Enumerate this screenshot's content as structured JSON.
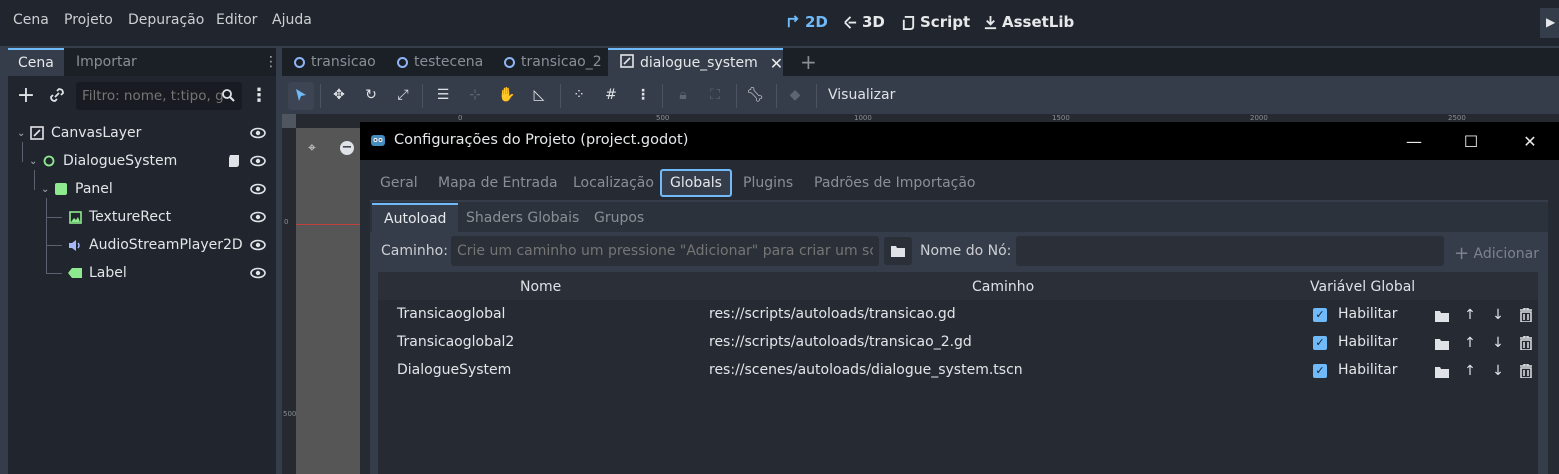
{
  "menubar": {
    "items": [
      "Cena",
      "Projeto",
      "Depuração",
      "Editor",
      "Ajuda"
    ],
    "main_buttons": [
      "2D",
      "3D",
      "Script",
      "AssetLib"
    ]
  },
  "left_dock": {
    "tabs": [
      "Cena",
      "Importar"
    ],
    "filter_placeholder": "Filtro: nome, t:tipo, g",
    "tree": [
      {
        "label": "CanvasLayer",
        "icon": "canvas-layer-icon"
      },
      {
        "label": "DialogueSystem",
        "icon": "node-icon"
      },
      {
        "label": "Panel",
        "icon": "panel-icon"
      },
      {
        "label": "TextureRect",
        "icon": "texture-rect-icon"
      },
      {
        "label": "AudioStreamPlayer2D",
        "icon": "audio-stream-icon"
      },
      {
        "label": "Label",
        "icon": "label-icon"
      }
    ]
  },
  "editor_tabs": [
    "transicao",
    "testecena",
    "transicao_2",
    "dialogue_system"
  ],
  "toolbar": {
    "view_label": "Visualizar"
  },
  "rulers": {
    "top": [
      "0",
      "500",
      "1000",
      "1500",
      "2000",
      "2500"
    ],
    "left": [
      "0",
      "500"
    ]
  },
  "dialog": {
    "title": "Configurações do Projeto (project.godot)",
    "tabs": [
      "Geral",
      "Mapa de Entrada",
      "Localização",
      "Globals",
      "Plugins",
      "Padrões de Importação"
    ],
    "subtabs": [
      "Autoload",
      "Shaders Globais",
      "Grupos"
    ],
    "path_label": "Caminho:",
    "path_placeholder": "Crie um caminho um pressione \"Adicionar\" para criar um script",
    "node_name_label": "Nome do Nó:",
    "add_label": "Adicionar",
    "columns": [
      "Nome",
      "Caminho",
      "Variável Global"
    ],
    "rows": [
      {
        "name": "Transicaoglobal",
        "path": "res://scripts/autoloads/transicao.gd",
        "enable": "Habilitar"
      },
      {
        "name": "Transicaoglobal2",
        "path": "res://scripts/autoloads/transicao_2.gd",
        "enable": "Habilitar"
      },
      {
        "name": "DialogueSystem",
        "path": "res://scenes/autoloads/dialogue_system.tscn",
        "enable": "Habilitar"
      }
    ]
  },
  "colors": {
    "accent": "#70bafa",
    "bg": "#363d4a",
    "dark": "#21262e"
  }
}
